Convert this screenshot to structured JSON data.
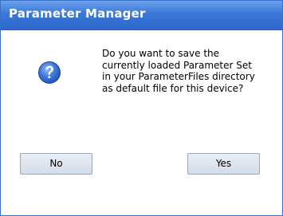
{
  "window": {
    "title": "Parameter Manager"
  },
  "dialog": {
    "icon": "question-icon",
    "message": "Do you want to save the\ncurrently loaded Parameter Set\nin your ParameterFiles directory\nas default file for this device?",
    "buttons": {
      "no_label": "No",
      "yes_label": "Yes"
    }
  },
  "colors": {
    "title_bar": "#3a78d8",
    "icon_fill": "#2f62c8"
  }
}
